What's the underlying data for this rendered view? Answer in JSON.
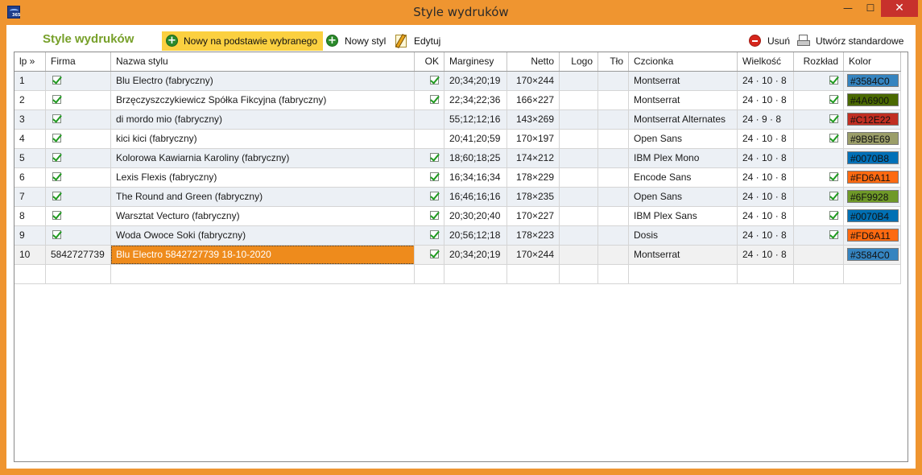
{
  "window": {
    "title": "Style wydruków",
    "minimize_glyph": "—",
    "maximize_glyph": "☐",
    "close_glyph": "✕",
    "app_icon_text": "365"
  },
  "toolbar": {
    "title": "Style wydruków",
    "new_based_on_selected": "Nowy na podstawie wybranego",
    "new_style": "Nowy styl",
    "edit": "Edytuj",
    "delete": "Usuń",
    "create_standard": "Utwórz standardowe"
  },
  "grid": {
    "headers": {
      "lp": "lp »",
      "firma": "Firma",
      "nazwa": "Nazwa stylu",
      "ok": "OK",
      "marginesy": "Marginesy",
      "netto": "Netto",
      "logo": "Logo",
      "tlo": "Tło",
      "czcionka": "Czcionka",
      "wielkosc": "Wielkość",
      "rozklad": "Rozkład",
      "kolor": "Kolor"
    },
    "rows": [
      {
        "lp": "1",
        "firma_checked": true,
        "firma": "",
        "nazwa": "Blu Electro (fabryczny)",
        "ok": true,
        "marginesy": "20;34;20;19",
        "netto": "170×244",
        "czcionka": "Montserrat",
        "wielkosc": "24 · 10 · 8",
        "rozklad": true,
        "kolor": "#3584C0"
      },
      {
        "lp": "2",
        "firma_checked": true,
        "firma": "",
        "nazwa": "Brzęczyszczykiewicz Spółka Fikcyjna (fabryczny)",
        "ok": true,
        "marginesy": "22;34;22;36",
        "netto": "166×227",
        "czcionka": "Montserrat",
        "wielkosc": "24 · 10 · 8",
        "rozklad": true,
        "kolor": "#4A6900"
      },
      {
        "lp": "3",
        "firma_checked": true,
        "firma": "",
        "nazwa": "di mordo mio (fabryczny)",
        "ok": false,
        "marginesy": "55;12;12;16",
        "netto": "143×269",
        "czcionka": "Montserrat Alternates",
        "wielkosc": "24 · 9 · 8",
        "rozklad": true,
        "kolor": "#C12E22"
      },
      {
        "lp": "4",
        "firma_checked": true,
        "firma": "",
        "nazwa": "kici kici (fabryczny)",
        "ok": false,
        "marginesy": "20;41;20;59",
        "netto": "170×197",
        "czcionka": "Open Sans",
        "wielkosc": "24 · 10 · 8",
        "rozklad": true,
        "kolor": "#9B9E69"
      },
      {
        "lp": "5",
        "firma_checked": true,
        "firma": "",
        "nazwa": "Kolorowa Kawiarnia Karoliny (fabryczny)",
        "ok": true,
        "marginesy": "18;60;18;25",
        "netto": "174×212",
        "czcionka": "IBM Plex Mono",
        "wielkosc": "24 · 10 · 8",
        "rozklad": false,
        "kolor": "#0070B8"
      },
      {
        "lp": "6",
        "firma_checked": true,
        "firma": "",
        "nazwa": "Lexis Flexis (fabryczny)",
        "ok": true,
        "marginesy": "16;34;16;34",
        "netto": "178×229",
        "czcionka": "Encode Sans",
        "wielkosc": "24 · 10 · 8",
        "rozklad": true,
        "kolor": "#FD6A11"
      },
      {
        "lp": "7",
        "firma_checked": true,
        "firma": "",
        "nazwa": "The Round and Green (fabryczny)",
        "ok": true,
        "marginesy": "16;46;16;16",
        "netto": "178×235",
        "czcionka": "Open Sans",
        "wielkosc": "24 · 10 · 8",
        "rozklad": true,
        "kolor": "#6F9928"
      },
      {
        "lp": "8",
        "firma_checked": true,
        "firma": "",
        "nazwa": "Warsztat Vecturo (fabryczny)",
        "ok": true,
        "marginesy": "20;30;20;40",
        "netto": "170×227",
        "czcionka": "IBM Plex Sans",
        "wielkosc": "24 · 10 · 8",
        "rozklad": true,
        "kolor": "#0070B4"
      },
      {
        "lp": "9",
        "firma_checked": true,
        "firma": "",
        "nazwa": "Woda Owoce Soki (fabryczny)",
        "ok": true,
        "marginesy": "20;56;12;18",
        "netto": "178×223",
        "czcionka": "Dosis",
        "wielkosc": "24 · 10 · 8",
        "rozklad": true,
        "kolor": "#FD6A11"
      },
      {
        "lp": "10",
        "firma_checked": false,
        "firma": "5842727739",
        "nazwa": "Blu Electro 5842727739 18-10-2020",
        "ok": true,
        "marginesy": "20;34;20;19",
        "netto": "170×244",
        "czcionka": "Montserrat",
        "wielkosc": "24 · 10 · 8",
        "rozklad": false,
        "kolor": "#3584C0"
      }
    ]
  },
  "colors": {
    "window_frame": "#EF9530",
    "title_accent": "#77A02A",
    "active_button": "#FBD040",
    "editing_cell": "#EE8B1C",
    "close_button": "#C7312C"
  },
  "icons": {
    "new_based_on_selected": "plus-circle-icon",
    "new_style": "plus-circle-icon",
    "edit": "pencil-note-icon",
    "delete": "minus-circle-icon",
    "create_standard": "printer-icon",
    "checkbox": "checkmark-icon"
  }
}
